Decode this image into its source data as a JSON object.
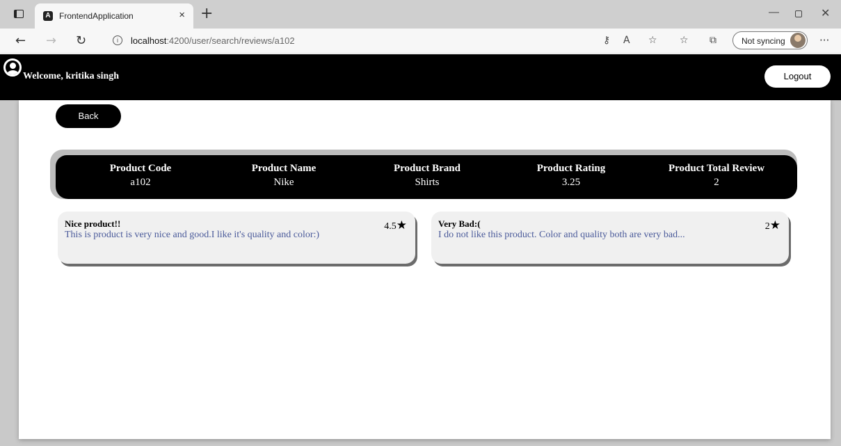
{
  "browser": {
    "tab_title": "FrontendApplication",
    "tab_close": "×",
    "new_tab": "+",
    "url_host": "localhost",
    "url_path": ":4200/user/search/reviews/a102",
    "sync_label": "Not syncing",
    "icons": {
      "back": "arrow-left-icon",
      "forward": "arrow-right-icon",
      "reload": "reload-icon",
      "info": "info-icon",
      "more": "more-icon"
    }
  },
  "header": {
    "welcome": "Welcome, kritika singh",
    "logout": "Logout"
  },
  "actions": {
    "back": "Back"
  },
  "summary": {
    "columns": [
      {
        "heading": "Product Code",
        "value": "a102"
      },
      {
        "heading": "Product Name",
        "value": "Nike"
      },
      {
        "heading": "Product Brand",
        "value": "Shirts"
      },
      {
        "heading": "Product Rating",
        "value": "3.25"
      },
      {
        "heading": "Product Total Review",
        "value": "2"
      }
    ]
  },
  "reviews": [
    {
      "title": "Nice product!!",
      "text": "This is product is very nice and good.I like it's quality and color:)",
      "rating": "4.5"
    },
    {
      "title": "Very Bad:(",
      "text": "I do not like this product. Color and quality both are very bad...",
      "rating": "2"
    }
  ],
  "colors": {
    "header_bg": "#000000",
    "card_bg": "#f0f0f0",
    "review_text": "#4a5a9a",
    "card_shadow": "#6b6b6b"
  }
}
